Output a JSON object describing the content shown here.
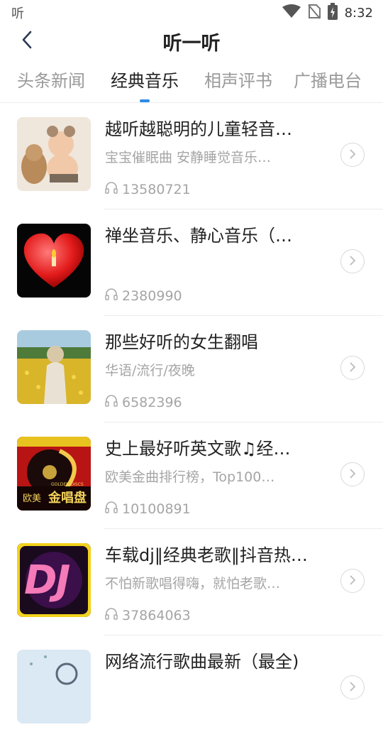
{
  "status_bar": {
    "left_label": "听",
    "time": "8:32"
  },
  "header": {
    "title": "听一听"
  },
  "tabs": [
    {
      "label": "头条新闻"
    },
    {
      "label": "经典音乐"
    },
    {
      "label": "相声评书"
    },
    {
      "label": "广播电台"
    }
  ],
  "items": [
    {
      "title": "越听越聪明的儿童轻音…",
      "subtitle": "宝宝催眠曲 安静睡觉音乐…",
      "count": "13580721"
    },
    {
      "title": "禅坐音乐、静心音乐（…",
      "subtitle": "",
      "count": "2380990"
    },
    {
      "title": "那些好听的女生翻唱",
      "subtitle": "华语/流行/夜晚",
      "count": "6582396"
    },
    {
      "title": "史上最好听英文歌♫经…",
      "subtitle": "欧美金曲排行榜，Top100…",
      "count": "10100891",
      "thumb_text": {
        "left": "欧美",
        "right": "金唱盘",
        "small": "GOLDEN DISCS"
      }
    },
    {
      "title": "车载dj‖经典老歌‖抖音热…",
      "subtitle": "不怕新歌唱得嗨，就怕老歌…",
      "count": "37864063",
      "thumb_text": {
        "main": "DJ"
      }
    },
    {
      "title": "网络流行歌曲最新（最全)",
      "subtitle": "",
      "count": ""
    }
  ],
  "colors": {
    "accent": "#2c8ae8"
  }
}
